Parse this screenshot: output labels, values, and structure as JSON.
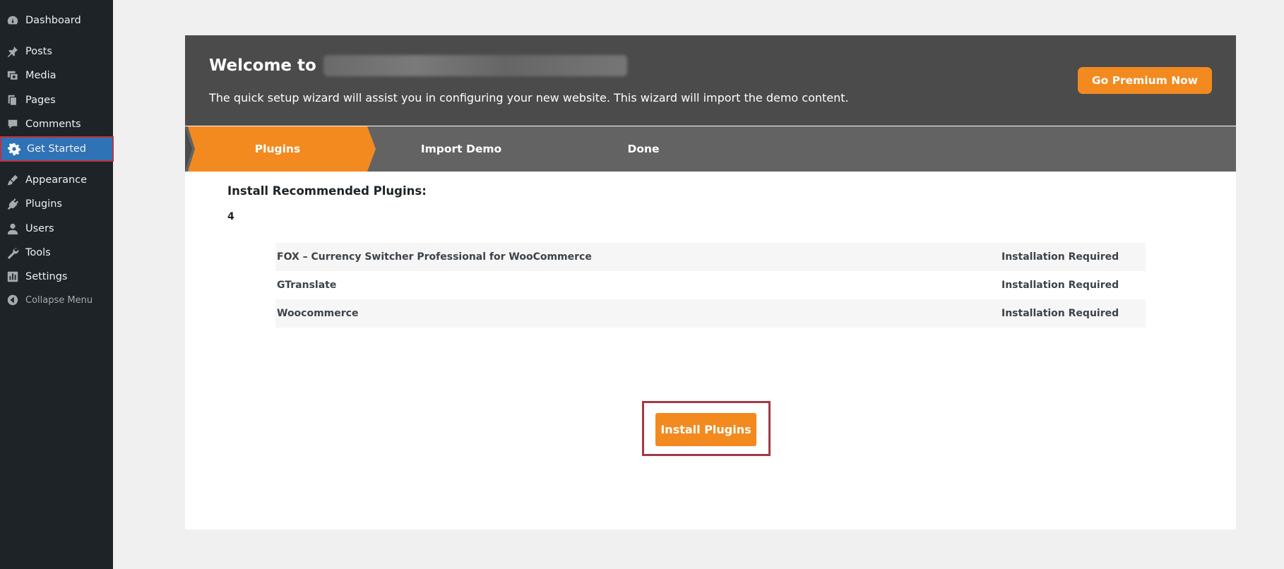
{
  "sidebar": {
    "items": [
      {
        "label": "Dashboard",
        "icon": "dashboard-icon"
      },
      {
        "label": "Posts",
        "icon": "pin-icon"
      },
      {
        "label": "Media",
        "icon": "media-icon"
      },
      {
        "label": "Pages",
        "icon": "pages-icon"
      },
      {
        "label": "Comments",
        "icon": "comment-icon"
      },
      {
        "label": "Get Started",
        "icon": "gear-icon",
        "active": true
      },
      {
        "label": "Appearance",
        "icon": "brush-icon"
      },
      {
        "label": "Plugins",
        "icon": "plug-icon"
      },
      {
        "label": "Users",
        "icon": "user-icon"
      },
      {
        "label": "Tools",
        "icon": "wrench-icon"
      },
      {
        "label": "Settings",
        "icon": "settings-icon"
      },
      {
        "label": "Collapse Menu",
        "icon": "collapse-icon"
      }
    ]
  },
  "header": {
    "welcome": "Welcome to",
    "description": "The quick setup wizard will assist you in configuring your new website. This wizard will import the demo content.",
    "premium_button": "Go Premium Now"
  },
  "steps": [
    {
      "label": "Plugins",
      "active": true
    },
    {
      "label": "Import Demo",
      "active": false
    },
    {
      "label": "Done",
      "active": false
    }
  ],
  "main": {
    "section_title": "Install Recommended Plugins:",
    "count": "4",
    "plugins": [
      {
        "name": "FOX – Currency Switcher Professional for WooCommerce",
        "status": "Installation Required"
      },
      {
        "name": "GTranslate",
        "status": "Installation Required"
      },
      {
        "name": "Woocommerce",
        "status": "Installation Required"
      }
    ],
    "install_button": "Install Plugins"
  },
  "colors": {
    "accent": "#f38a1f",
    "sidebar_bg": "#1d2327",
    "active_item": "#2f72b5",
    "header_bg": "#4b4b4b",
    "steps_bg": "#636363",
    "highlight_border": "#a23a45"
  }
}
